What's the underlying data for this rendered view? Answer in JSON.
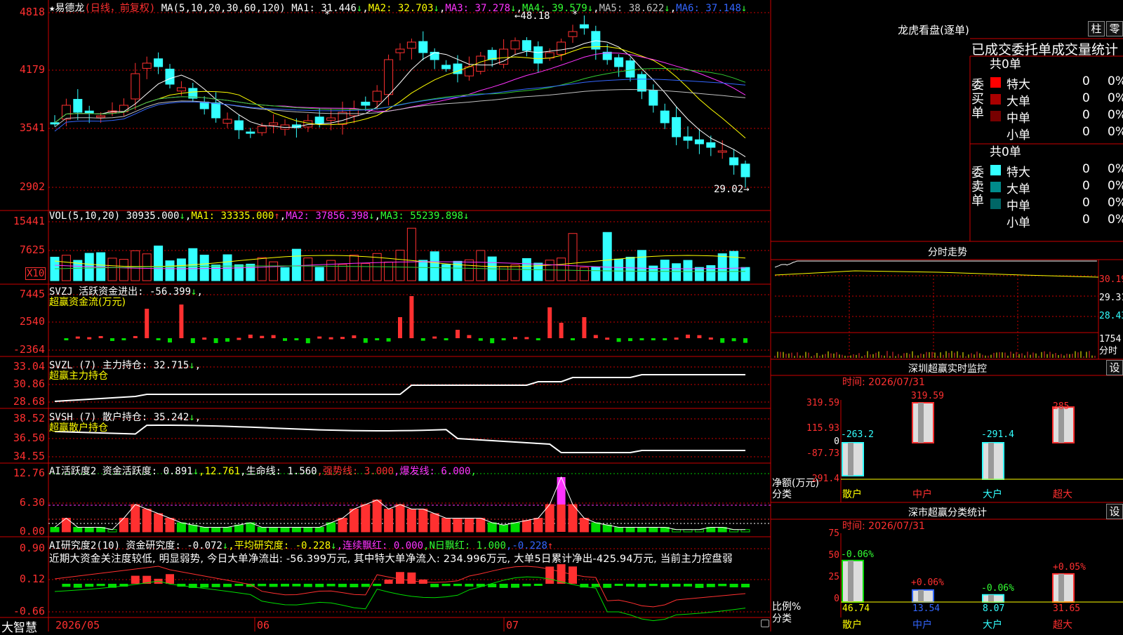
{
  "colors": {
    "up": "#ff3030",
    "down": "#33ffff",
    "ma1": "#ffffff",
    "ma2": "#ffff00",
    "ma3": "#ff33ff",
    "ma4": "#33cc33",
    "ma5": "#c0c0c0",
    "ma6": "#3366ff",
    "grid": "#cc0000"
  },
  "app": {
    "brand": "大智慧"
  },
  "main": {
    "stock": "★易德龙",
    "period": "(日线，前复权)",
    "ma_label": "MA(5,10,20,30,60,120)",
    "ma": [
      {
        "label": "MA1: 31.446",
        "arrow": "↓"
      },
      {
        "label": "MA2: 32.703",
        "arrow": "↓"
      },
      {
        "label": "MA3: 37.278",
        "arrow": "↓"
      },
      {
        "label": "MA4: 39.579",
        "arrow": "↓"
      },
      {
        "label": "MA5: 38.622",
        "arrow": "↓"
      },
      {
        "label": "MA6: 37.148",
        "arrow": "↓"
      }
    ],
    "axis": [
      "4818",
      "4179",
      "3541",
      "2902"
    ],
    "hi_label": "←48.18",
    "lo_label": "29.02→",
    "star": "*"
  },
  "vol": {
    "title": "VOL(5,10,20)",
    "value": "30935.000",
    "arrow": "↓",
    "ma1": "MA1: 33335.000",
    "ma1_arrow": "↑",
    "ma2": "MA2: 37856.398",
    "ma2_arrow": "↓",
    "ma3": "MA3: 55239.898",
    "ma3_arrow": "↓",
    "axis": [
      "15441",
      "7625"
    ],
    "unit": "X10"
  },
  "svzj": {
    "title": "SVZJ  活跃资金进出: -56.399",
    "arrow": "↓",
    "comma": ",",
    "sub": "超赢资金流(万元)",
    "axis": [
      "7445",
      "2540",
      "-2364"
    ]
  },
  "svzl": {
    "title": "SVZL (7) 主力持仓: 32.715",
    "arrow": "↓",
    "comma": ",",
    "sub": "超赢主力持仓",
    "axis": [
      "33.04",
      "30.86",
      "28.68"
    ]
  },
  "svsh": {
    "title": "SVSH (7) 散户持仓: 35.242",
    "arrow": "↓",
    "comma": ",",
    "sub": "超赢散户持仓",
    "axis": [
      "38.52",
      "36.50",
      "34.55"
    ]
  },
  "ai": {
    "title": "AI活跃度2 资金活跃度: 0.891",
    "a1": "↓",
    "v2": ",12.761",
    "v3": ",生命线: 1.560",
    "v4": ",强势线: 3.000",
    "v5": ",爆发线: 6.000",
    "v6": ",",
    "axis": [
      "12.76",
      "6.30",
      "0.00"
    ]
  },
  "air": {
    "title": "AI研究度2(10) 资金研究度: -0.072",
    "a1": "↓",
    "v2": ",平均研究度: -0.228",
    "a2": "↓",
    "v3": ",连续飘红: 0.000",
    "v4": ",N日飘红: 1.000",
    "v5": ",-0.228",
    "a5": "↑",
    "text": "近期大资金关注度较低, 明显弱势, 今日大单净流出: -56.399万元, 其中特大单净流入: 234.996万元, 大单5日累计净出-425.94万元, 当前主力控盘弱",
    "axis": [
      "0.90",
      "0.12",
      "-0.66"
    ]
  },
  "dates": [
    "2026/05",
    "06",
    "07"
  ],
  "right": {
    "lhkp": {
      "title": "龙虎看盘(逐单)",
      "btn1": "柱",
      "btn2": "零",
      "header": "已成交委托单成交量统计",
      "buy": {
        "label": "委买单",
        "count": "共0单",
        "rows": [
          {
            "name": "特大",
            "v": "0",
            "p": "0%",
            "c": "#ff0000"
          },
          {
            "name": "大单",
            "v": "0",
            "p": "0%",
            "c": "#aa0000"
          },
          {
            "name": "中单",
            "v": "0",
            "p": "0%",
            "c": "#770000"
          },
          {
            "name": "小单",
            "v": "0",
            "p": "0%",
            "c": "#000000"
          }
        ]
      },
      "sell": {
        "label": "委卖单",
        "count": "共0单",
        "rows": [
          {
            "name": "特大",
            "v": "0",
            "p": "0%",
            "c": "#33ffff"
          },
          {
            "name": "大单",
            "v": "0",
            "p": "0%",
            "c": "#008b8b"
          },
          {
            "name": "中单",
            "v": "0",
            "p": "0%",
            "c": "#006666"
          },
          {
            "name": "小单",
            "v": "0",
            "p": "0%",
            "c": "#000000"
          }
        ]
      }
    },
    "fs": {
      "title": "分时走势",
      "axis": [
        "30.19",
        "29.31",
        "28.43"
      ],
      "vol": "1754",
      "unit": "分时"
    },
    "szjk": {
      "title": "深圳超赢实时监控",
      "btn": "设",
      "time": "时间: 2026/07/31",
      "axis": [
        "319.59",
        "115.93",
        "0",
        "-87.73",
        "-291.4"
      ],
      "ylabel": "净额(万元)",
      "xlabel": "分类",
      "cats": [
        "散户",
        "中户",
        "大户",
        "超大"
      ],
      "values": [
        -263.2,
        319.59,
        -291.4,
        285
      ],
      "vlabels": [
        "-263.2",
        "319.59",
        "-291.4",
        "285"
      ]
    },
    "fltj": {
      "title": "深市超赢分类统计",
      "btn": "设",
      "time": "时间: 2026/07/31",
      "axis": [
        "75",
        "50",
        "25",
        "0"
      ],
      "ylabel": "比例%",
      "xlabel": "分类",
      "cats": [
        "散户",
        "中户",
        "大户",
        "超大"
      ],
      "values": [
        46.74,
        13.54,
        8.07,
        31.65
      ],
      "vlabels": [
        "46.74",
        "13.54",
        "8.07",
        "31.65"
      ],
      "chg": [
        "-0.06%",
        "+0.06%",
        "-0.06%",
        "+0.05%"
      ]
    }
  }
}
